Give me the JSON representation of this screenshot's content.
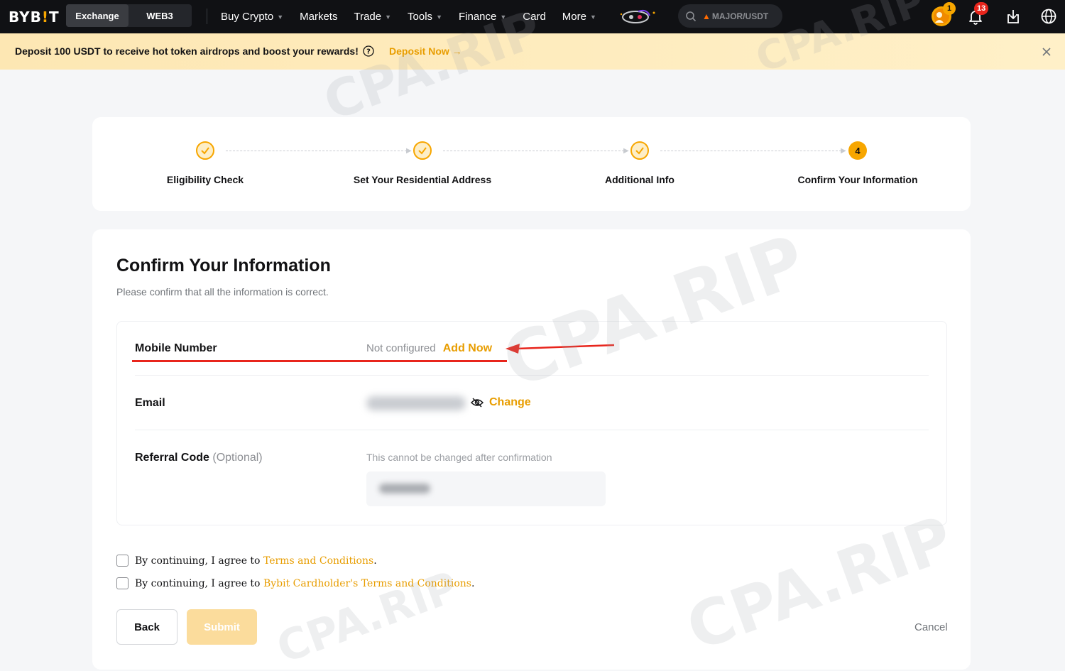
{
  "nav": {
    "logo": "BYB",
    "logo_dot": "!",
    "logo_end": "T",
    "segments": [
      "Exchange",
      "WEB3"
    ],
    "menu": [
      {
        "label": "Buy Crypto",
        "chevron": true
      },
      {
        "label": "Markets",
        "chevron": false
      },
      {
        "label": "Trade",
        "chevron": true
      },
      {
        "label": "Tools",
        "chevron": true
      },
      {
        "label": "Finance",
        "chevron": true
      },
      {
        "label": "Card",
        "chevron": false
      },
      {
        "label": "More",
        "chevron": true
      }
    ],
    "search_text": "MAJOR/USDT",
    "rewards_badge": "1",
    "notifications_badge": "13"
  },
  "banner": {
    "text": "Deposit 100 USDT to receive hot token airdrops and boost your rewards!",
    "link": "Deposit Now →"
  },
  "stepper": {
    "steps": [
      {
        "label": "Eligibility Check",
        "state": "done"
      },
      {
        "label": "Set Your Residential Address",
        "state": "done"
      },
      {
        "label": "Additional Info",
        "state": "done"
      },
      {
        "label": "Confirm Your Information",
        "state": "current",
        "number": "4"
      }
    ]
  },
  "form": {
    "title": "Confirm Your Information",
    "subtitle": "Please confirm that all the information is correct.",
    "mobile": {
      "label": "Mobile Number",
      "status": "Not configured",
      "action": "Add Now"
    },
    "email": {
      "label": "Email",
      "action": "Change"
    },
    "referral": {
      "label": "Referral Code",
      "optional": "(Optional)",
      "hint": "This cannot be changed after confirmation"
    },
    "agree1": {
      "prefix": "By continuing, I agree to ",
      "link": "Terms and Conditions",
      "suffix": "."
    },
    "agree2": {
      "prefix": "By continuing, I agree to ",
      "link": "Bybit Cardholder's Terms and Conditions",
      "suffix": "."
    },
    "back": "Back",
    "submit": "Submit",
    "cancel": "Cancel"
  },
  "watermark": "CPA.RIP",
  "colors": {
    "accent": "#f7a600",
    "link": "#e89d00",
    "nav_bg": "#101114",
    "annotation": "#e8251c"
  }
}
